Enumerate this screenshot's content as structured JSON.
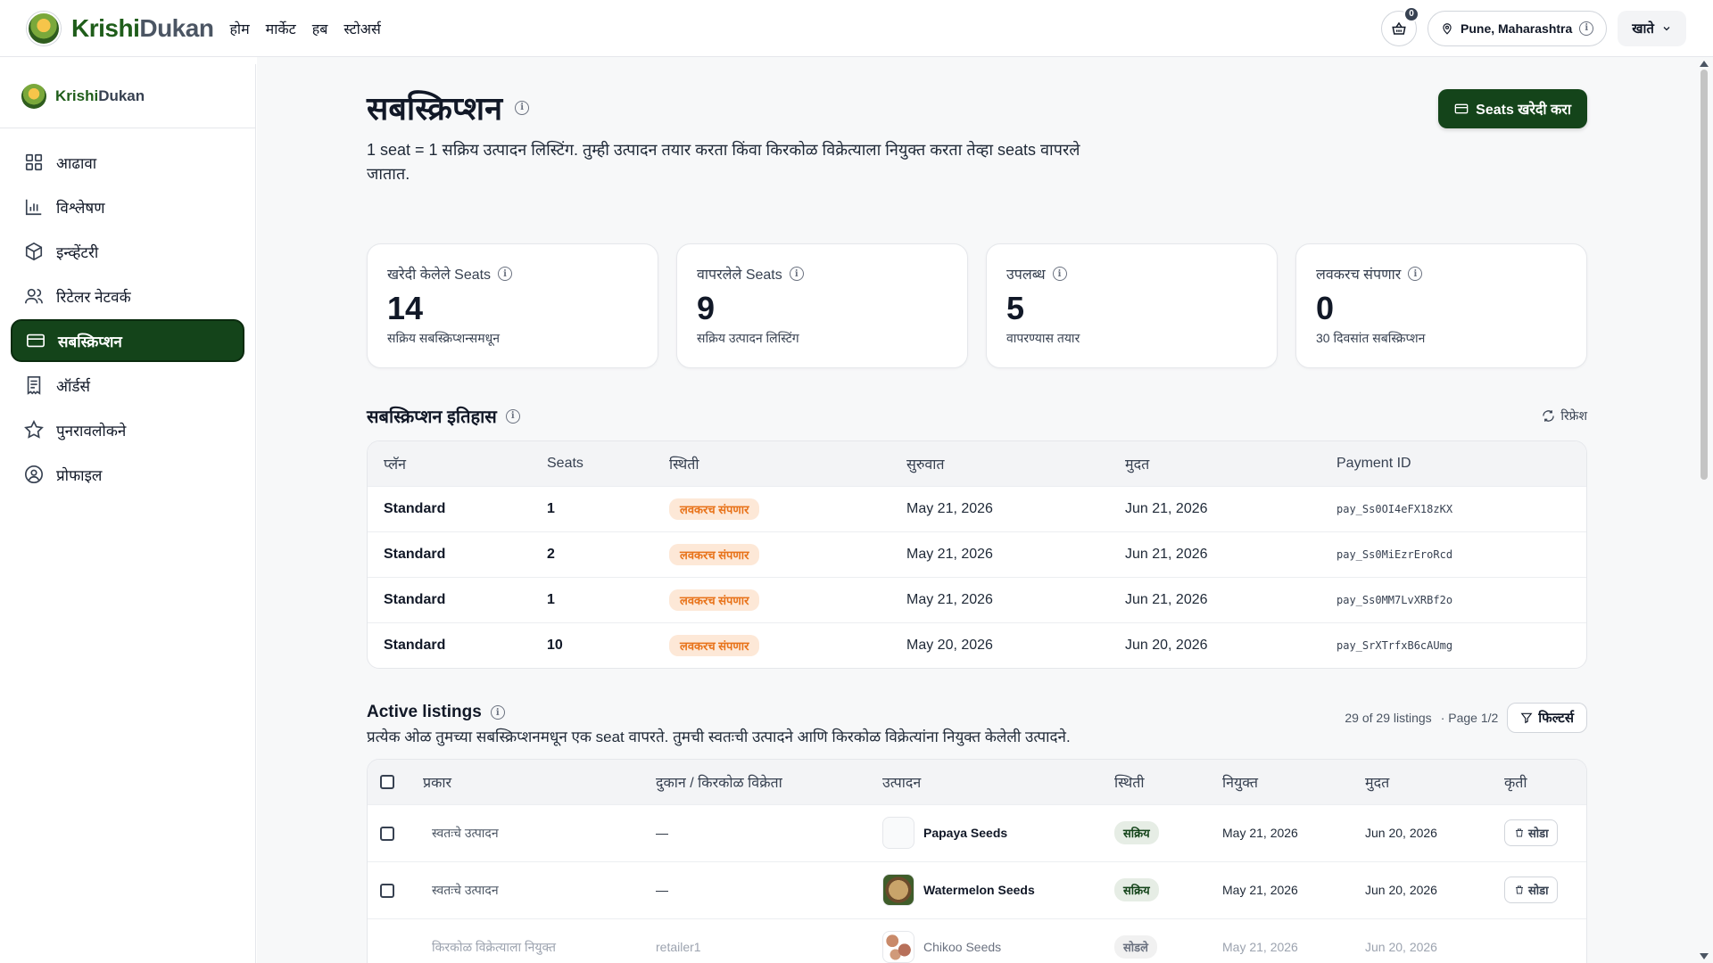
{
  "header": {
    "brand_primary": "Krishi",
    "brand_secondary": "Dukan",
    "nav": [
      "होम",
      "मार्केट",
      "हब",
      "स्टोअर्स"
    ],
    "cart_count": "0",
    "location": "Pune, Maharashtra",
    "account_label": "खाते"
  },
  "sidebar": {
    "brand_primary": "Krishi",
    "brand_secondary": "Dukan",
    "items": [
      {
        "label": "आढावा",
        "icon": "grid-icon"
      },
      {
        "label": "विश्लेषण",
        "icon": "bar-chart-icon"
      },
      {
        "label": "इन्व्हेंटरी",
        "icon": "box-icon"
      },
      {
        "label": "रिटेलर नेटवर्क",
        "icon": "users-icon"
      },
      {
        "label": "सबस्क्रिप्शन",
        "icon": "credit-card-icon",
        "active": true
      },
      {
        "label": "ऑर्डर्स",
        "icon": "receipt-icon"
      },
      {
        "label": "पुनरावलोकने",
        "icon": "star-icon"
      },
      {
        "label": "प्रोफाइल",
        "icon": "user-circle-icon"
      }
    ]
  },
  "page": {
    "title": "सबस्क्रिप्शन",
    "subtitle": "1 seat = 1 सक्रिय उत्पादन लिस्टिंग. तुम्ही उत्पादन तयार करता किंवा किरकोळ विक्रेत्याला नियुक्त करता तेव्हा seats वापरले जातात.",
    "buy_button": "Seats खरेदी करा"
  },
  "stats": [
    {
      "label": "खरेदी केलेले Seats",
      "value": "14",
      "sub": "सक्रिय सबस्क्रिप्शन्समधून"
    },
    {
      "label": "वापरलेले Seats",
      "value": "9",
      "sub": "सक्रिय उत्पादन लिस्टिंग"
    },
    {
      "label": "उपलब्ध",
      "value": "5",
      "sub": "वापरण्यास तयार"
    },
    {
      "label": "लवकरच संपणार",
      "value": "0",
      "sub": "30 दिवसांत सबस्क्रिप्शन"
    }
  ],
  "history": {
    "title": "सबस्क्रिप्शन इतिहास",
    "refresh": "रिफ्रेश",
    "columns": [
      "प्लॅन",
      "Seats",
      "स्थिती",
      "सुरुवात",
      "मुदत",
      "Payment ID"
    ],
    "rows": [
      {
        "plan": "Standard",
        "seats": "1",
        "status": "लवकरच संपणार",
        "start": "May 21, 2026",
        "end": "Jun 21, 2026",
        "payment_id": "pay_Ss0OI4eFX18zKX"
      },
      {
        "plan": "Standard",
        "seats": "2",
        "status": "लवकरच संपणार",
        "start": "May 21, 2026",
        "end": "Jun 21, 2026",
        "payment_id": "pay_Ss0MiEzrEroRcd"
      },
      {
        "plan": "Standard",
        "seats": "1",
        "status": "लवकरच संपणार",
        "start": "May 21, 2026",
        "end": "Jun 21, 2026",
        "payment_id": "pay_Ss0MM7LvXRBf2o"
      },
      {
        "plan": "Standard",
        "seats": "10",
        "status": "लवकरच संपणार",
        "start": "May 20, 2026",
        "end": "Jun 20, 2026",
        "payment_id": "pay_SrXTrfxB6cAUmg"
      }
    ]
  },
  "listings": {
    "title": "Active listings",
    "subtitle": "प्रत्येक ओळ तुमच्या सबस्क्रिप्शनमधून एक seat वापरते. तुमची स्वतःची उत्पादने आणि किरकोळ विक्रेत्यांना नियुक्त केलेली उत्पादने.",
    "count_text": "29 of 29 listings",
    "page_text": "· Page 1/2",
    "filter_button": "फिल्टर्स",
    "columns": [
      "प्रकार",
      "दुकान / किरकोळ विक्रेता",
      "उत्पादन",
      "स्थिती",
      "नियुक्त",
      "मुदत",
      "कृती"
    ],
    "rows": [
      {
        "type": "स्वतःचे उत्पादन",
        "shop": "—",
        "product": "Papaya Seeds",
        "thumb": "papaya",
        "status": "सक्रिय",
        "assigned": "May 21, 2026",
        "expiry": "Jun 20, 2026",
        "action": "सोडा"
      },
      {
        "type": "स्वतःचे उत्पादन",
        "shop": "—",
        "product": "Watermelon Seeds",
        "thumb": "melon",
        "status": "सक्रिय",
        "assigned": "May 21, 2026",
        "expiry": "Jun 20, 2026",
        "action": "सोडा"
      },
      {
        "type": "किरकोळ विक्रेत्याला नियुक्त",
        "shop": "retailer1",
        "product": "Chikoo Seeds",
        "thumb": "chikoo",
        "status": "सोडले",
        "assigned": "May 21, 2026",
        "expiry": "Jun 20, 2026",
        "action": ""
      }
    ]
  },
  "colors": {
    "primary": "#14441a",
    "warn_bg": "#fde8d7",
    "warn_text": "#e8731a",
    "ok_bg": "#e6ede5"
  }
}
